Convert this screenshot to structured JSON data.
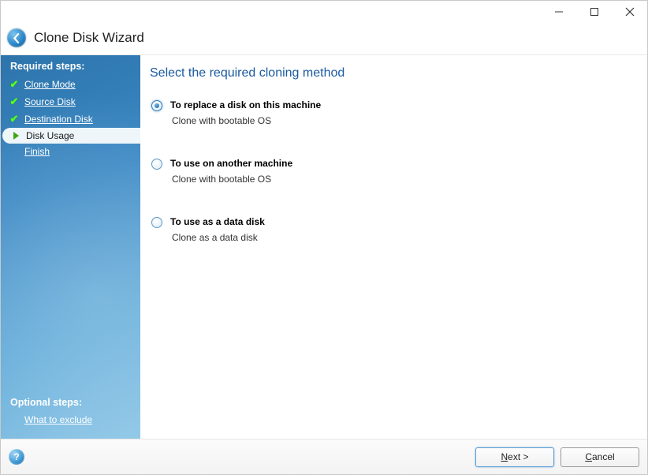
{
  "window": {
    "title": "Clone Disk Wizard"
  },
  "sidebar": {
    "required_heading": "Required steps:",
    "optional_heading": "Optional steps:",
    "steps": [
      {
        "label": "Clone Mode",
        "state": "done"
      },
      {
        "label": "Source Disk",
        "state": "done"
      },
      {
        "label": "Destination Disk",
        "state": "done"
      },
      {
        "label": "Disk Usage",
        "state": "current"
      },
      {
        "label": "Finish",
        "state": "pending"
      }
    ],
    "optional_steps": [
      {
        "label": "What to exclude"
      }
    ]
  },
  "main": {
    "heading": "Select the required cloning method",
    "options": [
      {
        "title": "To replace a disk on this machine",
        "desc": "Clone with bootable OS",
        "selected": true
      },
      {
        "title": "To use on another machine",
        "desc": "Clone with bootable OS",
        "selected": false
      },
      {
        "title": "To use as a data disk",
        "desc": "Clone as a data disk",
        "selected": false
      }
    ]
  },
  "footer": {
    "help": "?",
    "next_prefix": "N",
    "next_rest": "ext >",
    "cancel_prefix": "C",
    "cancel_rest": "ancel"
  }
}
